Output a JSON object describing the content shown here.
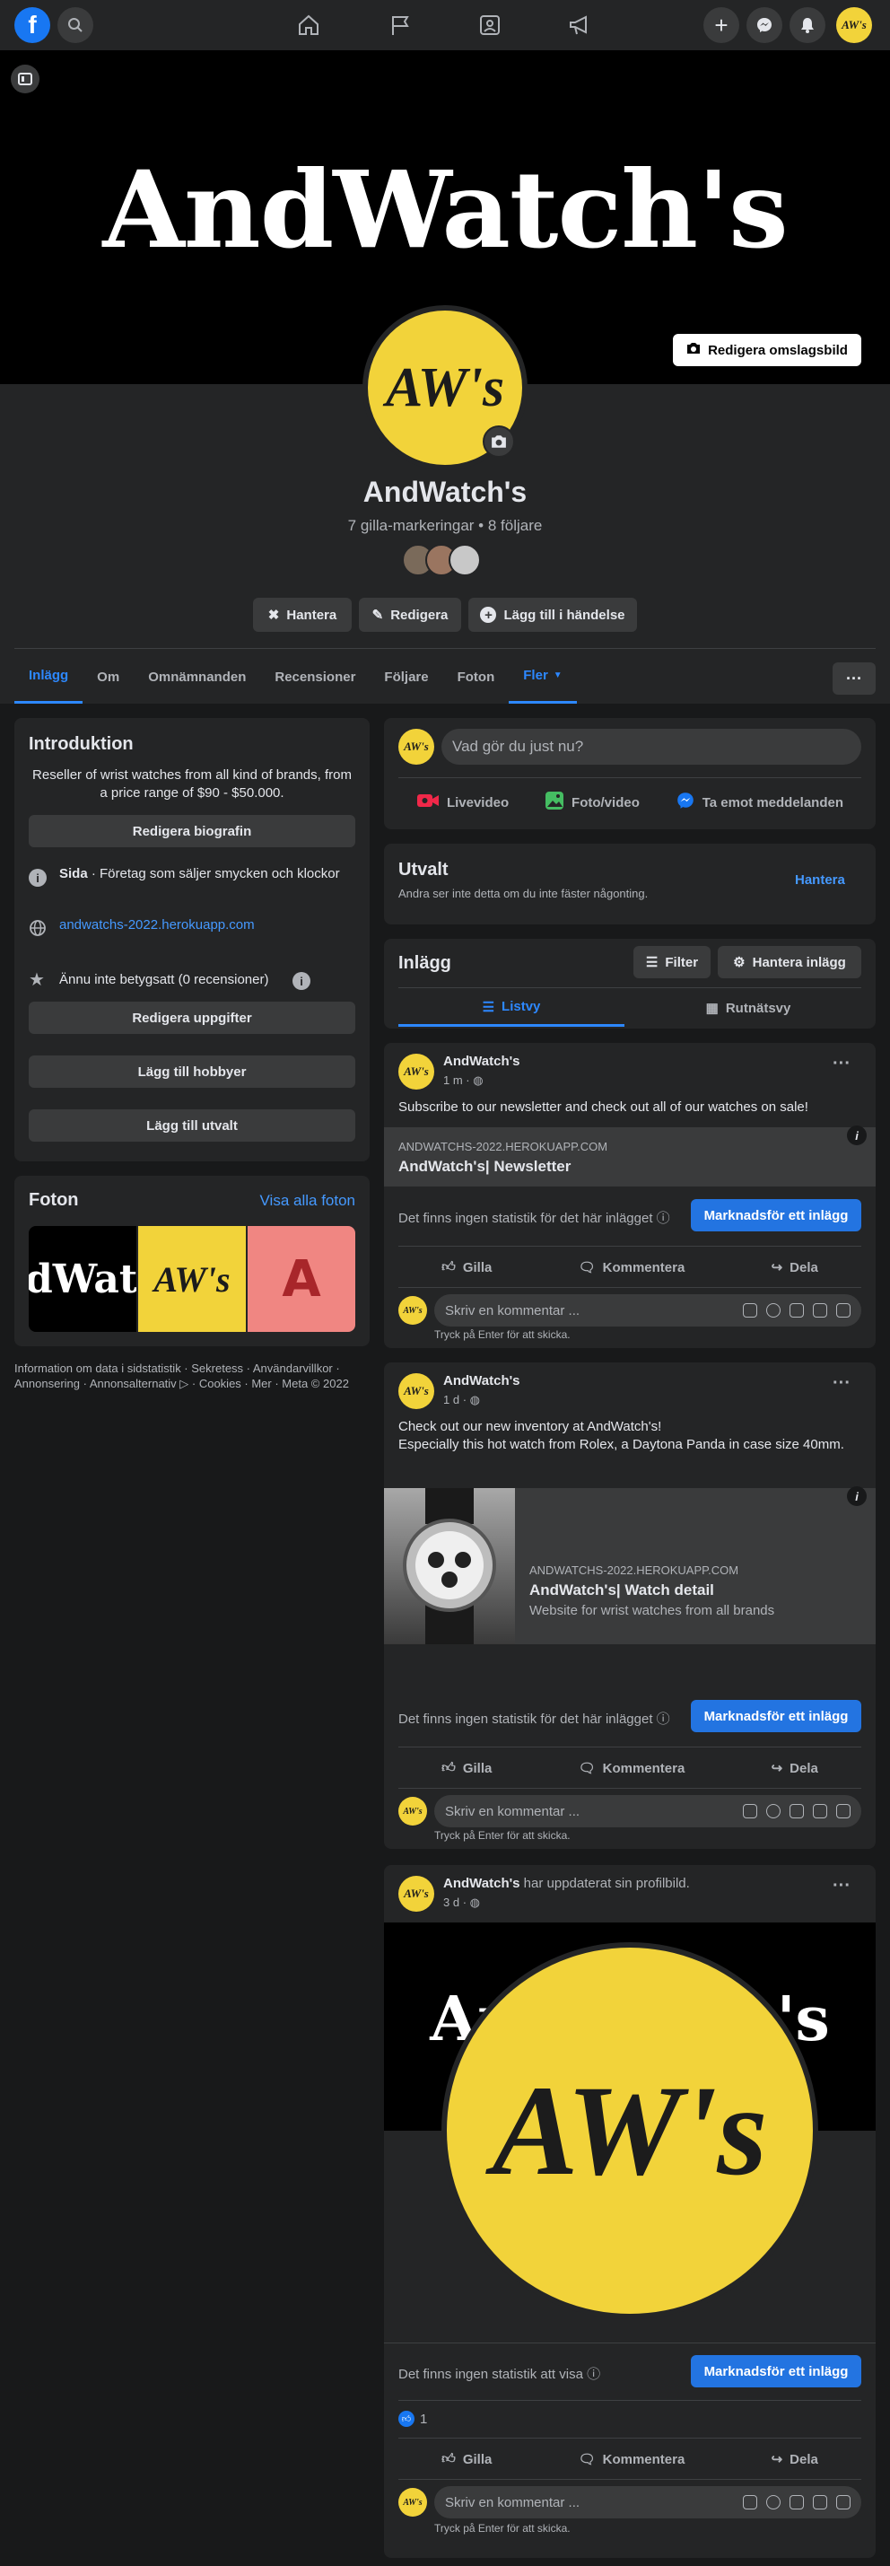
{
  "cover": {
    "title": "AndWatch's",
    "edit_label": "Redigera omslagsbild"
  },
  "profile": {
    "logo_text": "AW's",
    "name": "AndWatch's",
    "stats": "7 gilla-markeringar • 8 följare",
    "buttons": {
      "manage": "Hantera",
      "edit": "Redigera",
      "add_event": "Lägg till i händelse"
    }
  },
  "tabs": [
    "Inlägg",
    "Om",
    "Omnämnanden",
    "Recensioner",
    "Följare",
    "Foton",
    "Fler"
  ],
  "intro": {
    "heading": "Introduktion",
    "bio": "Reseller of wrist watches from all kind of brands, from a price range of $90 - $50.000.",
    "edit_bio": "Redigera biografin",
    "page_label": "Sida",
    "page_category": " · Företag som säljer smycken och klockor",
    "website": "andwatchs-2022.herokuapp.com",
    "rating": "Ännu inte betygsatt (0 recensioner)",
    "edit_details": "Redigera uppgifter",
    "add_hobbies": "Lägg till hobbyer",
    "add_featured": "Lägg till utvalt"
  },
  "photos": {
    "heading": "Foton",
    "see_all": "Visa alla foton",
    "thumb1": "dWatc",
    "thumb3": "A"
  },
  "footer": "Information om data i sidstatistik · Sekretess · Användarvillkor · Annonsering · Annonsalternativ ▷ · Cookies · Mer · Meta © 2022",
  "composer": {
    "placeholder": "Vad gör du just nu?",
    "live": "Livevideo",
    "photo": "Foto/video",
    "messages": "Ta emot meddelanden"
  },
  "featured": {
    "heading": "Utvalt",
    "sub": "Andra ser inte detta om du inte fäster någonting.",
    "manage": "Hantera"
  },
  "posts_header": {
    "heading": "Inlägg",
    "filter": "Filter",
    "manage": "Hantera inlägg",
    "list_view": "Listvy",
    "grid_view": "Rutnätsvy"
  },
  "posts": [
    {
      "author": "AndWatch's",
      "time": "1 m",
      "text": "Subscribe to our newsletter and check out all of our watches on sale!",
      "link_domain": "ANDWATCHS-2022.HEROKUAPP.COM",
      "link_title": "AndWatch's| Newsletter",
      "stats_text": "Det finns ingen statistik för det här inlägget",
      "promote": "Marknadsför ett inlägg"
    },
    {
      "author": "AndWatch's",
      "time": "1 d",
      "text": "Check out our new inventory at AndWatch's!\nEspecially this hot watch from Rolex, a Daytona Panda in case size 40mm.",
      "link_domain": "ANDWATCHS-2022.HEROKUAPP.COM",
      "link_title": "AndWatch's| Watch detail",
      "link_desc": "Website for wrist watches from all brands",
      "stats_text": "Det finns ingen statistik för det här inlägget",
      "promote": "Marknadsför ett inlägg"
    },
    {
      "author": "AndWatch's",
      "action": " har uppdaterat sin profilbild.",
      "time": "3 d",
      "stats_text": "Det finns ingen statistik att visa",
      "promote": "Marknadsför ett inlägg",
      "likes": "1"
    }
  ],
  "actions": {
    "like": "Gilla",
    "comment": "Kommentera",
    "share": "Dela"
  },
  "comment": {
    "placeholder": "Skriv en kommentar ...",
    "hint": "Tryck på Enter för att skicka."
  }
}
